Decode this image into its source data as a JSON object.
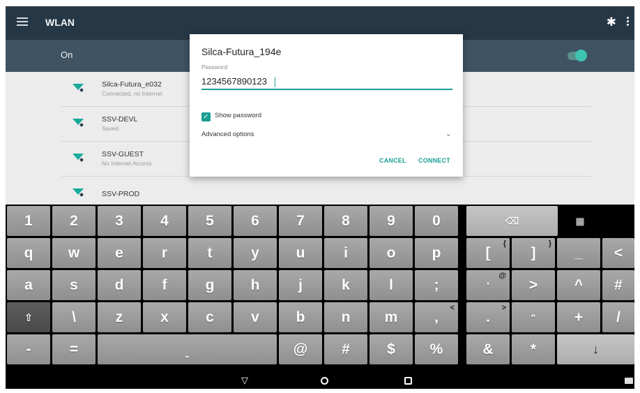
{
  "appbar": {
    "title": "WLAN",
    "toggle_label": "On",
    "toggle_on": true
  },
  "networks": [
    {
      "name": "Silca-Futura_e032",
      "status": "Connected, no Internet"
    },
    {
      "name": "SSV-DEVL",
      "status": "Saved"
    },
    {
      "name": "SSV-GUEST",
      "status": "No Internet Access."
    },
    {
      "name": "SSV-PROD",
      "status": ""
    }
  ],
  "dialog": {
    "title": "Silca-Futura_194e",
    "password_label": "Password",
    "password_value": "1234567890123",
    "show_password_label": "Show password",
    "show_password_checked": true,
    "advanced_label": "Advanced options",
    "cancel_label": "CANCEL",
    "connect_label": "CONNECT"
  },
  "keyboard": {
    "row1": [
      "1",
      "2",
      "3",
      "4",
      "5",
      "6",
      "7",
      "8",
      "9",
      "0"
    ],
    "row2": [
      "q",
      "w",
      "e",
      "r",
      "t",
      "y",
      "u",
      "i",
      "o",
      "p",
      "[",
      "]",
      "_",
      "<"
    ],
    "row2_hints": [
      "",
      "",
      "",
      "",
      "",
      "",
      "",
      "",
      "",
      "",
      "{",
      "}",
      "",
      ""
    ],
    "row3": [
      "a",
      "s",
      "d",
      "f",
      "g",
      "h",
      "j",
      "k",
      "l",
      ";",
      "'",
      "@",
      ">",
      "^",
      "#"
    ],
    "row4": [
      "z",
      "x",
      "c",
      "v",
      "b",
      "n",
      "m",
      ",",
      ".",
      " \"",
      "+",
      "/"
    ],
    "row5": [
      "-",
      "=",
      "@",
      "#",
      "$",
      "%",
      "&",
      "*"
    ]
  },
  "colors": {
    "accent": "#1a9e92",
    "appbar": "#263745",
    "toolbar": "#3f5363"
  }
}
